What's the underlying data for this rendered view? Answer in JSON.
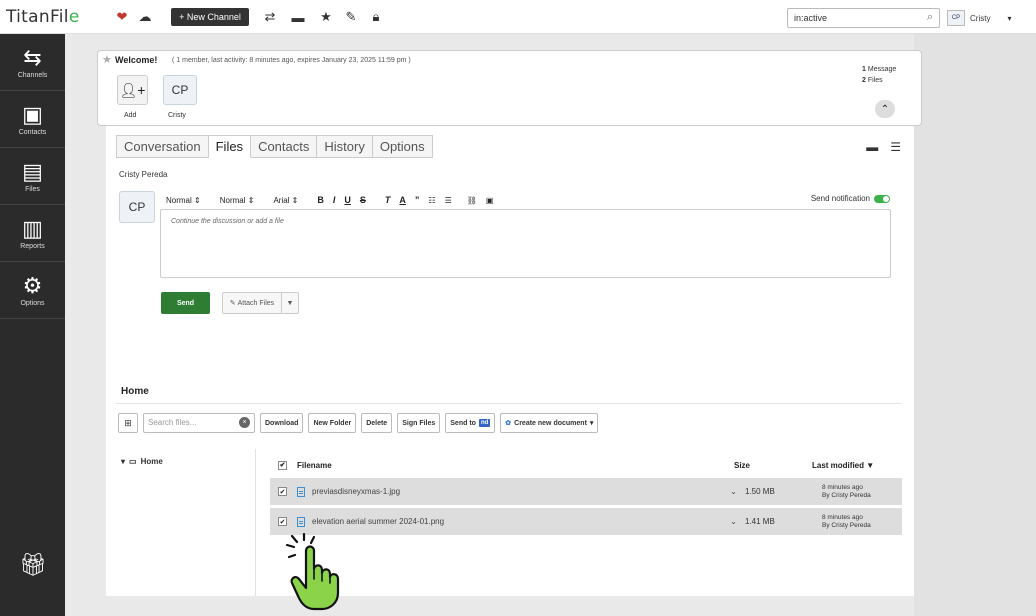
{
  "app": {
    "logo_main": "TitanFil",
    "logo_accent": "e"
  },
  "topbar": {
    "new_channel_label": "+ New Channel",
    "search_value": "in:active",
    "user_initials": "CP",
    "user_name": "Cristy"
  },
  "sidebar": {
    "items": [
      {
        "label": "Channels",
        "icon": "arrows-icon"
      },
      {
        "label": "Contacts",
        "icon": "contact-card-icon"
      },
      {
        "label": "Files",
        "icon": "file-icon"
      },
      {
        "label": "Reports",
        "icon": "bar-chart-icon"
      },
      {
        "label": "Options",
        "icon": "gear-icon"
      }
    ]
  },
  "welcome": {
    "title": "Welcome!",
    "meta": "( 1 member, last activity: 8 minutes ago, expires January 23, 2025 11:59 pm )",
    "add_label": "Add",
    "member_initials": "CP",
    "member_name": "Cristy",
    "message_count": "1",
    "message_label": "Message",
    "file_count": "2",
    "file_label": "Files"
  },
  "tabs": [
    "Conversation",
    "Files",
    "Contacts",
    "History",
    "Options"
  ],
  "active_tab": "Files",
  "composer": {
    "person": "Cristy Pereda",
    "initials": "CP",
    "style_select": "Normal",
    "size_select": "Normal",
    "font_select": "Arial",
    "send_notification_label": "Send notification",
    "placeholder": "Continue the discussion or add a file",
    "send_label": "Send",
    "attach_label": "Attach Files"
  },
  "files": {
    "folder_title": "Home",
    "search_placeholder": "Search files...",
    "buttons": {
      "download": "Download",
      "new_folder": "New Folder",
      "delete": "Delete",
      "sign": "Sign Files",
      "send_to": "Send to",
      "send_to_badge": "nd",
      "create": "Create new document"
    },
    "tree_root": "Home",
    "columns": {
      "filename": "Filename",
      "size": "Size",
      "modified": "Last modified"
    },
    "rows": [
      {
        "name": "previasdisneyxmas-1.jpg",
        "size": "1.50 MB",
        "modified_time": "8 minutes ago",
        "modified_by": "By Cristy Pereda"
      },
      {
        "name": "elevation aerial summer 2024-01.png",
        "size": "1.41 MB",
        "modified_time": "8 minutes ago",
        "modified_by": "By Cristy Pereda"
      }
    ]
  },
  "colors": {
    "accent_green": "#3cb34a",
    "send_green": "#2e7d32",
    "sidebar_bg": "#2b2b2b",
    "hand_fill": "#8bd44a"
  }
}
